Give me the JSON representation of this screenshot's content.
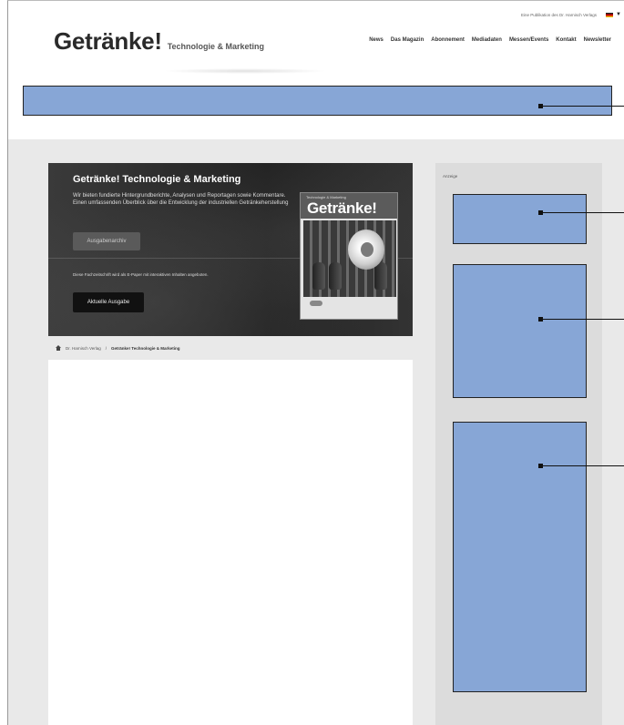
{
  "header": {
    "publisher_text": "Eine Publikation des Dr. Harnisch Verlags",
    "logo_main": "Getränke!",
    "logo_sub": "Technologie & Marketing",
    "nav": [
      "News",
      "Das Magazin",
      "Abonnement",
      "Mediadaten",
      "Messen/Events",
      "Kontakt",
      "Newsletter"
    ]
  },
  "hero": {
    "title": "Getränke! Technologie & Marketing",
    "description": "Wir bieten fundierte Hintergrundberichte, Analysen und Reportagen sowie Kommentare. Einen umfassenden Überblick über die Entwicklung der industriellen Getränkeherstellung",
    "issues_button": "Ausgabenarchiv",
    "epaper_note": "Diese Fachzeitschrift wird als E-Paper mit interaktiven Inhalten angeboten.",
    "current_button": "Aktuelle Ausgabe",
    "cover_title": "Getränke!",
    "cover_kicker": "Technologie & Marketing"
  },
  "breadcrumb": {
    "home": "Dr. Harnisch Verlag",
    "separator": "/",
    "current": "Getränke! Technologie & Marketing"
  },
  "sidebar": {
    "ad_label": "Anzeige"
  },
  "colors": {
    "ad_placeholder": "#87a6d6",
    "background_band": "#e9e9e9",
    "hero_dark": "#2b2b2b"
  }
}
